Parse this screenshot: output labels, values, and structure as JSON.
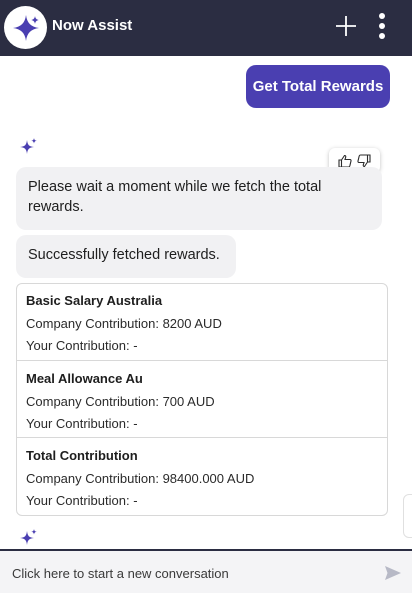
{
  "header": {
    "title": "Now Assist",
    "logo_icon": "sparkle-icon",
    "new_chat_icon": "plus-icon",
    "menu_icon": "kebab-menu-icon"
  },
  "conversation": {
    "user_message": "Get Total Rewards",
    "bot_messages": [
      "Please wait a moment while we fetch the total rewards.",
      "Successfully fetched rewards."
    ],
    "feedback": {
      "like_icon": "thumbs-up-icon",
      "dislike_icon": "thumbs-down-icon"
    },
    "rewards": [
      {
        "name": "Basic Salary Australia",
        "company": "Company Contribution: 8200 AUD",
        "yours": "Your Contribution: -"
      },
      {
        "name": "Meal Allowance Au",
        "company": "Company Contribution: 700 AUD",
        "yours": "Your Contribution: -"
      },
      {
        "name": "Total Contribution",
        "company": "Company Contribution: 98400.000 AUD",
        "yours": "Your Contribution: -"
      }
    ]
  },
  "composer": {
    "placeholder": "Click here to start a new conversation",
    "send_icon": "send-icon"
  },
  "colors": {
    "header_bg": "#2b2d42",
    "accent": "#4a3fb1",
    "bubble_bg": "#f1f1f3"
  }
}
